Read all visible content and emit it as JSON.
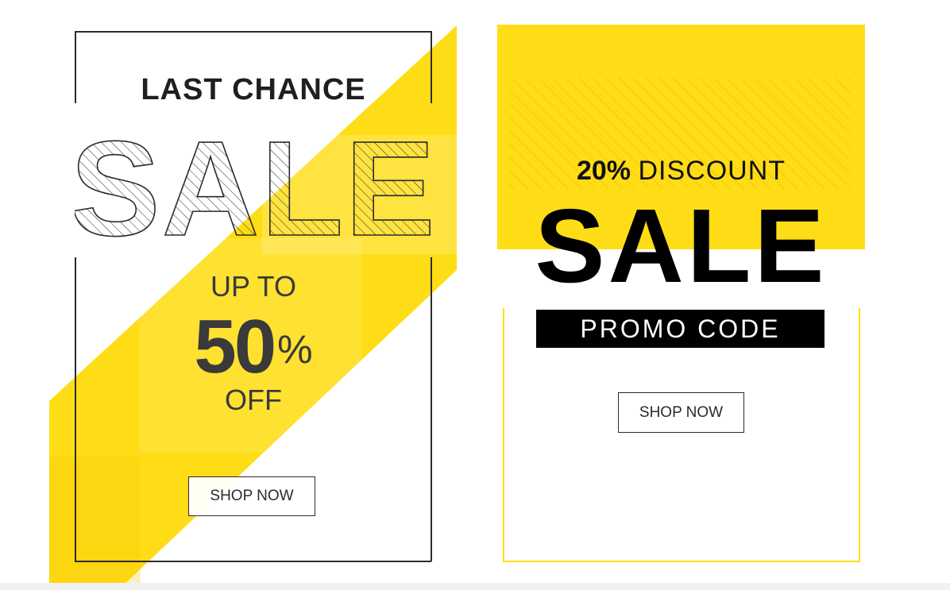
{
  "colors": {
    "accent_yellow": "#ffdd16",
    "ink": "#1f1f1f",
    "gray_text": "#3a3a3a",
    "black": "#000000",
    "white": "#ffffff"
  },
  "banner_left": {
    "headline": "LAST CHANCE",
    "sale_text": "SALE",
    "up_to": "UP TO",
    "percent_number": "50",
    "percent_sign": "%",
    "off": "OFF",
    "button_label": "SHOP NOW"
  },
  "banner_right": {
    "discount_bold": "20%",
    "discount_label": "DISCOUNT",
    "sale_text": "SALE",
    "promo_label": "PROMO CODE",
    "button_label": "SHOP NOW"
  }
}
